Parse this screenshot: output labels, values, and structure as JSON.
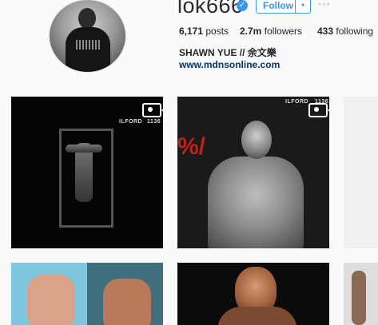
{
  "profile": {
    "username": "lok666",
    "verified_icon": "verified-badge-icon",
    "follow_label": "Follow",
    "dropdown_icon": "▾",
    "more_icon": "◦◦◦",
    "posts_count": "6,171",
    "posts_label": "posts",
    "followers_count": "2.7m",
    "followers_label": "followers",
    "following_count": "433",
    "following_label": "following",
    "bio_name": "SHAWN YUE // 余文樂",
    "bio_link": "www.mdnsonline.com"
  },
  "posts": [
    {
      "type": "video",
      "film_label": "ILFORD",
      "frame_number": "1136"
    },
    {
      "type": "video",
      "film_label": "ILFORD",
      "frame_number": "1136",
      "red_text": "%/"
    },
    {
      "type": "photo"
    },
    {
      "type": "photo"
    },
    {
      "type": "photo"
    },
    {
      "type": "photo"
    }
  ],
  "colors": {
    "accent": "#3897f0",
    "link": "#003569",
    "background": "#fafafa",
    "text": "#262626"
  }
}
